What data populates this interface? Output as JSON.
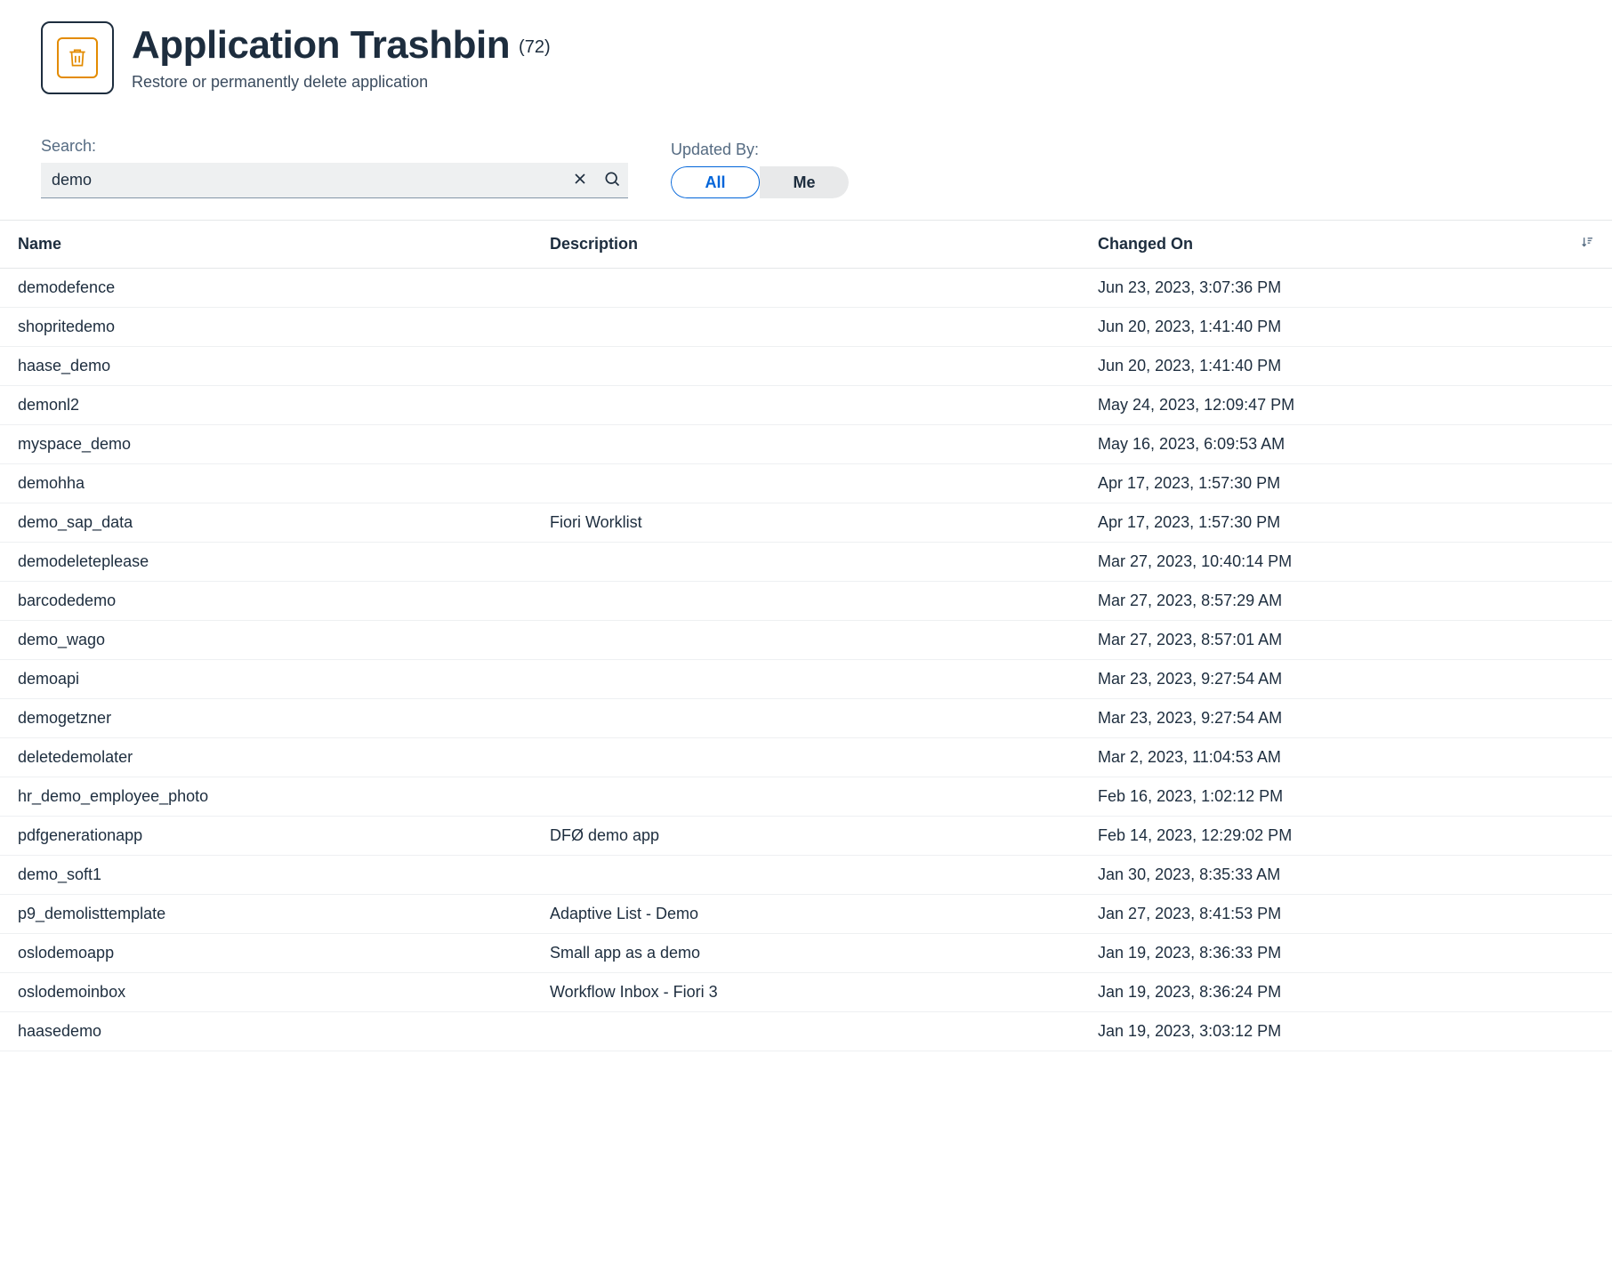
{
  "header": {
    "title": "Application Trashbin",
    "count": "(72)",
    "subtitle": "Restore or permanently delete application"
  },
  "filters": {
    "search_label": "Search:",
    "search_value": "demo",
    "updated_by_label": "Updated By:",
    "seg_all": "All",
    "seg_me": "Me"
  },
  "table": {
    "columns": {
      "name": "Name",
      "description": "Description",
      "changed_on": "Changed On"
    },
    "rows": [
      {
        "name": "demodefence",
        "description": "",
        "changed_on": "Jun 23, 2023, 3:07:36 PM"
      },
      {
        "name": "shopritedemo",
        "description": "",
        "changed_on": "Jun 20, 2023, 1:41:40 PM"
      },
      {
        "name": "haase_demo",
        "description": "",
        "changed_on": "Jun 20, 2023, 1:41:40 PM"
      },
      {
        "name": "demonl2",
        "description": "",
        "changed_on": "May 24, 2023, 12:09:47 PM"
      },
      {
        "name": "myspace_demo",
        "description": "",
        "changed_on": "May 16, 2023, 6:09:53 AM"
      },
      {
        "name": "demohha",
        "description": "",
        "changed_on": "Apr 17, 2023, 1:57:30 PM"
      },
      {
        "name": "demo_sap_data",
        "description": "Fiori Worklist",
        "changed_on": "Apr 17, 2023, 1:57:30 PM"
      },
      {
        "name": "demodeleteplease",
        "description": "",
        "changed_on": "Mar 27, 2023, 10:40:14 PM"
      },
      {
        "name": "barcodedemo",
        "description": "",
        "changed_on": "Mar 27, 2023, 8:57:29 AM"
      },
      {
        "name": "demo_wago",
        "description": "",
        "changed_on": "Mar 27, 2023, 8:57:01 AM"
      },
      {
        "name": "demoapi",
        "description": "",
        "changed_on": "Mar 23, 2023, 9:27:54 AM"
      },
      {
        "name": "demogetzner",
        "description": "",
        "changed_on": "Mar 23, 2023, 9:27:54 AM"
      },
      {
        "name": "deletedemolater",
        "description": "",
        "changed_on": "Mar 2, 2023, 11:04:53 AM"
      },
      {
        "name": "hr_demo_employee_photo",
        "description": "",
        "changed_on": "Feb 16, 2023, 1:02:12 PM"
      },
      {
        "name": "pdfgenerationapp",
        "description": "DFØ demo app",
        "changed_on": "Feb 14, 2023, 12:29:02 PM"
      },
      {
        "name": "demo_soft1",
        "description": "",
        "changed_on": "Jan 30, 2023, 8:35:33 AM"
      },
      {
        "name": "p9_demolisttemplate",
        "description": "Adaptive List - Demo",
        "changed_on": "Jan 27, 2023, 8:41:53 PM"
      },
      {
        "name": "oslodemoapp",
        "description": "Small app as a demo",
        "changed_on": "Jan 19, 2023, 8:36:33 PM"
      },
      {
        "name": "oslodemoinbox",
        "description": "Workflow Inbox - Fiori 3",
        "changed_on": "Jan 19, 2023, 8:36:24 PM"
      },
      {
        "name": "haasedemo",
        "description": "",
        "changed_on": "Jan 19, 2023, 3:03:12 PM"
      }
    ]
  }
}
